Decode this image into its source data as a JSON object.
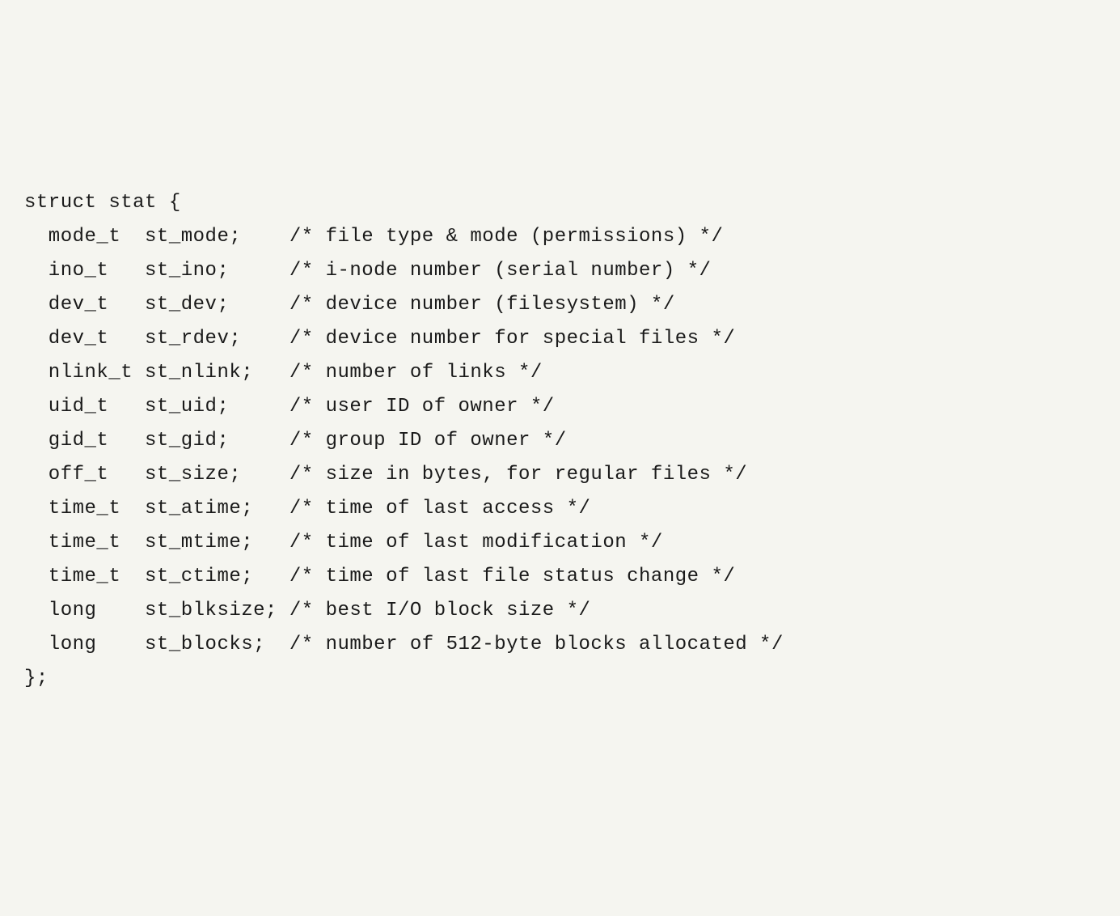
{
  "struct_decl": "struct stat {",
  "members": [
    {
      "type": "mode_t",
      "name": "st_mode;",
      "comment": "/* file type & mode (permissions) */"
    },
    {
      "type": "ino_t",
      "name": "st_ino;",
      "comment": "/* i-node number (serial number) */"
    },
    {
      "type": "dev_t",
      "name": "st_dev;",
      "comment": "/* device number (filesystem) */"
    },
    {
      "type": "dev_t",
      "name": "st_rdev;",
      "comment": "/* device number for special files */"
    },
    {
      "type": "nlink_t",
      "name": "st_nlink;",
      "comment": "/* number of links */"
    },
    {
      "type": "uid_t",
      "name": "st_uid;",
      "comment": "/* user ID of owner */"
    },
    {
      "type": "gid_t",
      "name": "st_gid;",
      "comment": "/* group ID of owner */"
    },
    {
      "type": "off_t",
      "name": "st_size;",
      "comment": "/* size in bytes, for regular files */"
    },
    {
      "type": "time_t",
      "name": "st_atime;",
      "comment": "/* time of last access */"
    },
    {
      "type": "time_t",
      "name": "st_mtime;",
      "comment": "/* time of last modification */"
    },
    {
      "type": "time_t",
      "name": "st_ctime;",
      "comment": "/* time of last file status change */"
    },
    {
      "type": "long",
      "name": "st_blksize;",
      "comment": "/* best I/O block size */"
    },
    {
      "type": "long",
      "name": "st_blocks;",
      "comment": "/* number of 512-byte blocks allocated */"
    }
  ],
  "struct_close": "};",
  "col_type_width": 8,
  "col_name_width": 12
}
